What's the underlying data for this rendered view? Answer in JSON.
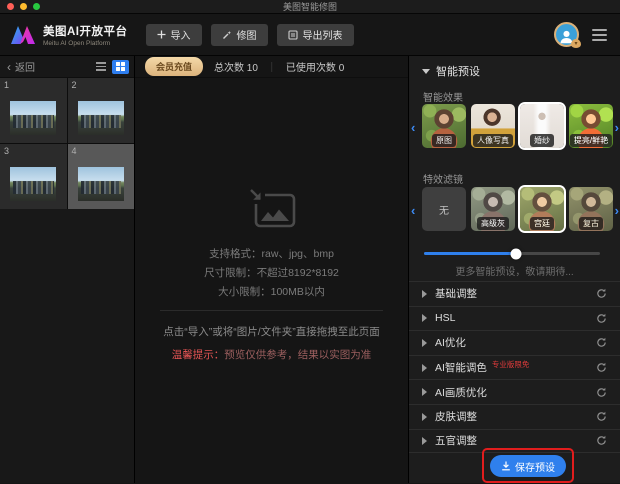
{
  "colors": {
    "accent_blue": "#2f80ed",
    "member_gold": "#e8c28a",
    "annotation_red": "#e11d1d",
    "tip_red": "#e05353",
    "selected_border": "#ffffff"
  },
  "titlebar": {
    "title": "美图智能修图"
  },
  "header": {
    "logo_title": "美图AI开放平台",
    "logo_subtitle": "Meitu AI Open Platform",
    "import_button": "导入",
    "retouch_button": "修图",
    "export_button": "导出列表"
  },
  "sidebar": {
    "back_label": "返回",
    "thumbnails": [
      {
        "index": "1",
        "selected": false
      },
      {
        "index": "2",
        "selected": false
      },
      {
        "index": "3",
        "selected": false
      },
      {
        "index": "4",
        "selected": true
      }
    ]
  },
  "workspace": {
    "recharge_label": "会员充值",
    "stats_total": "总次数 10",
    "stats_separator": "｜",
    "stats_used": "已使用次数 0",
    "support_format": "支持格式：raw、jpg、bmp",
    "dimension_limit": "尺寸限制：不超过8192*8192",
    "size_limit": "大小限制：100MB以内",
    "drop_hint": "点击“导入”或将“图片/文件夹”直接拖拽至此页面",
    "tip_prefix": "温馨提示：",
    "tip_text": "预览仅供参考，结果以实图为准"
  },
  "panel": {
    "preset_title": "智能预设",
    "effects_label": "智能效果",
    "effects": [
      {
        "label": "原图",
        "selected": false
      },
      {
        "label": "人像写真",
        "selected": false
      },
      {
        "label": "婚纱",
        "selected": true
      },
      {
        "label": "提亮/鲜艳",
        "selected": false
      }
    ],
    "filters_label": "特效滤镜",
    "filters": [
      {
        "label": "无",
        "selected": false
      },
      {
        "label": "高级灰",
        "selected": false
      },
      {
        "label": "宫廷",
        "selected": true
      },
      {
        "label": "复古",
        "selected": false
      }
    ],
    "filter_strength_percent": 52,
    "more_hint": "更多智能预设，敬请期待...",
    "sections": [
      {
        "label": "基础调整"
      },
      {
        "label": "HSL"
      },
      {
        "label": "AI优化"
      },
      {
        "label": "AI智能调色",
        "badge": "专业版限免"
      },
      {
        "label": "AI画质优化"
      },
      {
        "label": "皮肤调整"
      },
      {
        "label": "五官调整"
      }
    ],
    "save_button": "保存预设"
  }
}
